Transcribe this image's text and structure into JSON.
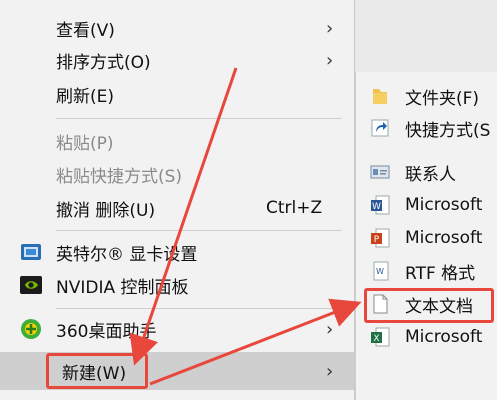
{
  "context_menu": {
    "items": [
      {
        "label": "查看(V)",
        "has_submenu": true
      },
      {
        "label": "排序方式(O)",
        "has_submenu": true
      },
      {
        "label": "刷新(E)"
      },
      {
        "label": "粘贴(P)",
        "disabled": true
      },
      {
        "label": "粘贴快捷方式(S)",
        "disabled": true
      },
      {
        "label": "撤消 删除(U)",
        "shortcut": "Ctrl+Z"
      },
      {
        "label": "英特尔® 显卡设置"
      },
      {
        "label": "NVIDIA 控制面板"
      },
      {
        "label": "360桌面助手",
        "has_submenu": true
      },
      {
        "label": "新建(W)",
        "has_submenu": true,
        "active": true
      }
    ]
  },
  "new_submenu": {
    "items": [
      {
        "label": "文件夹(F)",
        "icon": "folder-icon"
      },
      {
        "label": "快捷方式(S",
        "icon": "shortcut-icon"
      },
      {
        "label": "联系人",
        "icon": "contact-icon"
      },
      {
        "label": "Microsoft",
        "icon": "word-doc-icon"
      },
      {
        "label": "Microsoft",
        "icon": "powerpoint-icon"
      },
      {
        "label": "RTF 格式",
        "icon": "rtf-doc-icon"
      },
      {
        "label": "文本文档",
        "icon": "text-document-icon",
        "highlighted": true
      },
      {
        "label": "Microsoft",
        "icon": "excel-icon"
      }
    ]
  },
  "colors": {
    "annotation_red": "#e8473c",
    "active_bg": "#cfcfcf",
    "menu_bg": "#f2f2f2"
  }
}
